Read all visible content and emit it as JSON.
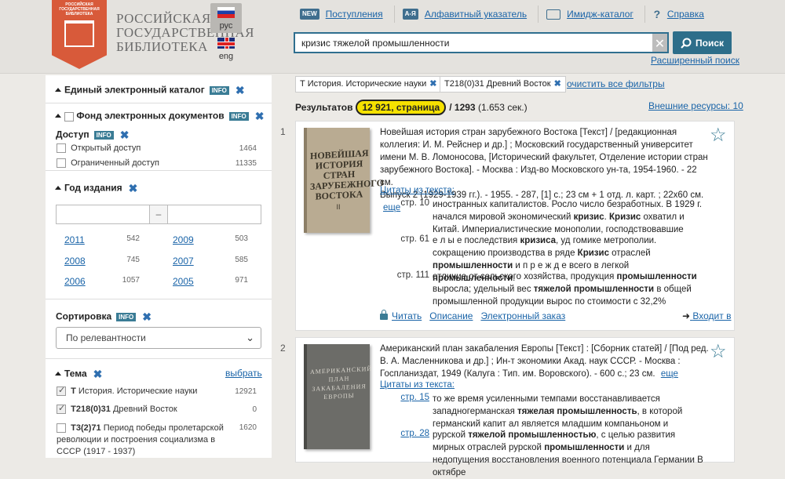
{
  "header": {
    "logo_small_text": "РОССИЙСКАЯ ГОСУДАРСТВЕННАЯ БИБЛИОТЕКА",
    "logo_line1": "РОССИЙСКАЯ",
    "logo_line2": "ГОСУДАРСТВЕННАЯ",
    "logo_line3": "БИБЛИОТЕКА",
    "lang_ru": "рус",
    "lang_en": "eng",
    "nav": [
      {
        "icon": "NEW",
        "label": "Поступления"
      },
      {
        "icon": "А-Я",
        "label": "Алфавитный указатель"
      },
      {
        "icon": "",
        "label": "Имидж-каталог"
      },
      {
        "icon": "?",
        "label": "Справка"
      }
    ],
    "search_value": "кризис тяжелой промышленности",
    "search_clear": "✕",
    "search_button": "Поиск",
    "advanced_search": "Расширенный поиск"
  },
  "sidebar": {
    "catalog_title": "Единый электронный каталог",
    "info": "INFO",
    "remove": "✖",
    "fund_title": "Фонд электронных документов",
    "access_title": "Доступ",
    "access_items": [
      {
        "label": "Открытый доступ",
        "count": "1464"
      },
      {
        "label": "Ограниченный доступ",
        "count": "11335"
      }
    ],
    "year_title": "Год издания",
    "year_dash": "–",
    "years": [
      {
        "year": "2011",
        "count": "542"
      },
      {
        "year": "2009",
        "count": "503"
      },
      {
        "year": "2008",
        "count": "745"
      },
      {
        "year": "2007",
        "count": "585"
      },
      {
        "year": "2006",
        "count": "1057"
      },
      {
        "year": "2005",
        "count": "971"
      }
    ],
    "sort_title": "Сортировка",
    "sort_value": "По релевантности",
    "topic_title": "Тема",
    "topic_choose": "выбрать",
    "topics": [
      {
        "code": "Т",
        "label": "История. Исторические науки",
        "count": "12921"
      },
      {
        "code": "Т218(0)31",
        "label": "Древний Восток",
        "count": "0"
      },
      {
        "code": "Т3(2)71",
        "label": "Период победы пролетарской революции и построения социализма в СССР (1917 - 1937)",
        "count": "1620"
      }
    ]
  },
  "filters": {
    "chip1": "Т История. Исторические науки",
    "chip2": "Т218(0)31 Древний Восток",
    "chip_x": "✖",
    "clear_all": "очистить все фильтры"
  },
  "results": {
    "label": "Результатов",
    "highlight": "12 921, страница",
    "pages": "/ 1293",
    "time": "(1.653 сек.)",
    "external": "Внешние ресурсы: 10"
  },
  "cards": [
    {
      "num": "1",
      "cover_title": "НОВЕЙШАЯ ИСТОРИЯ СТРАН ЗАРУБЕЖНОГО ВОСТОКА",
      "cover_vol": "II",
      "desc": "Новейшая история стран зарубежного Востока [Текст] / [редакционная коллегия: И. М. Рейснер и др.] ; Московский государственный университет имени М. В. Ломоносова, [Исторический факультет, Отделение истории стран зарубежного Востока]. - Москва : Изд-во Московского ун-та, 1954-1960. - 22 см.",
      "desc2": "Выпуск 2 (1929-1939 гг.). - 1955. - 287, [1] с.; 23 см + 1 отд. л. карт. ; 22x60 см.",
      "more": "еще",
      "citations_label": "Цитаты из текста:",
      "citations": [
        {
          "page": "стр. 10",
          "text": "иностранных капиталистов. Росло число безработных. В 1929 г. начался мировой экономический <b>кризис</b>. <b>Кризис</b> охватил и Китай. Империалистические монополии, господствовавшие"
        },
        {
          "page": "стр. 61",
          "text": "е л ы е последствия <b>кризиса</b>, уд гомике метрополии. сокращению производства в ряде <b>Кризис</b> отраслей <b>промышленности</b> и п р е ж д е всего в легкой <b>промышленности</b>."
        },
        {
          "page": "стр. 111",
          "text": "отличие от сельского хозяйства, продукция <b>промышленности</b> выросла; удельный вес <b>тяжелой промышленности</b> в общей промышленной продукции вырос по стоимости с 32,2%"
        }
      ],
      "read": "Читать",
      "description": "Описание",
      "order": "Электронный заказ",
      "goto": "Входит в"
    },
    {
      "num": "2",
      "cover_title": "АМЕРИКАНСКИЙ ПЛАН ЗАКАБАЛЕНИЯ ЕВРОПЫ",
      "desc": "Американский план закабаления Европы [Текст] : [Сборник статей] / [Под ред. В. А. Масленникова и др.] ; Ин-т экономики Акад. наук СССР. - Москва : Госпланиздат, 1949 (Калуга : Тип. им. Воровского). - 600 с.; 23 см.",
      "more": "еще",
      "citations_label": "Цитаты из текста:",
      "citations": [
        {
          "page": "стр. 15",
          "text": "то же время усиленными темпами восстанавливается западногерманская <b>тяжелая промышленность</b>, в которой германский капит ал является младшим компаньоном и"
        },
        {
          "page": "стр. 28",
          "text": "рурской <b>тяжелой промышленностью</b>, с целью развития мирных отраслей рурской <b>промышленности</b> и для недопущения восстановления военного потенциала Германии В октябре"
        }
      ]
    }
  ]
}
